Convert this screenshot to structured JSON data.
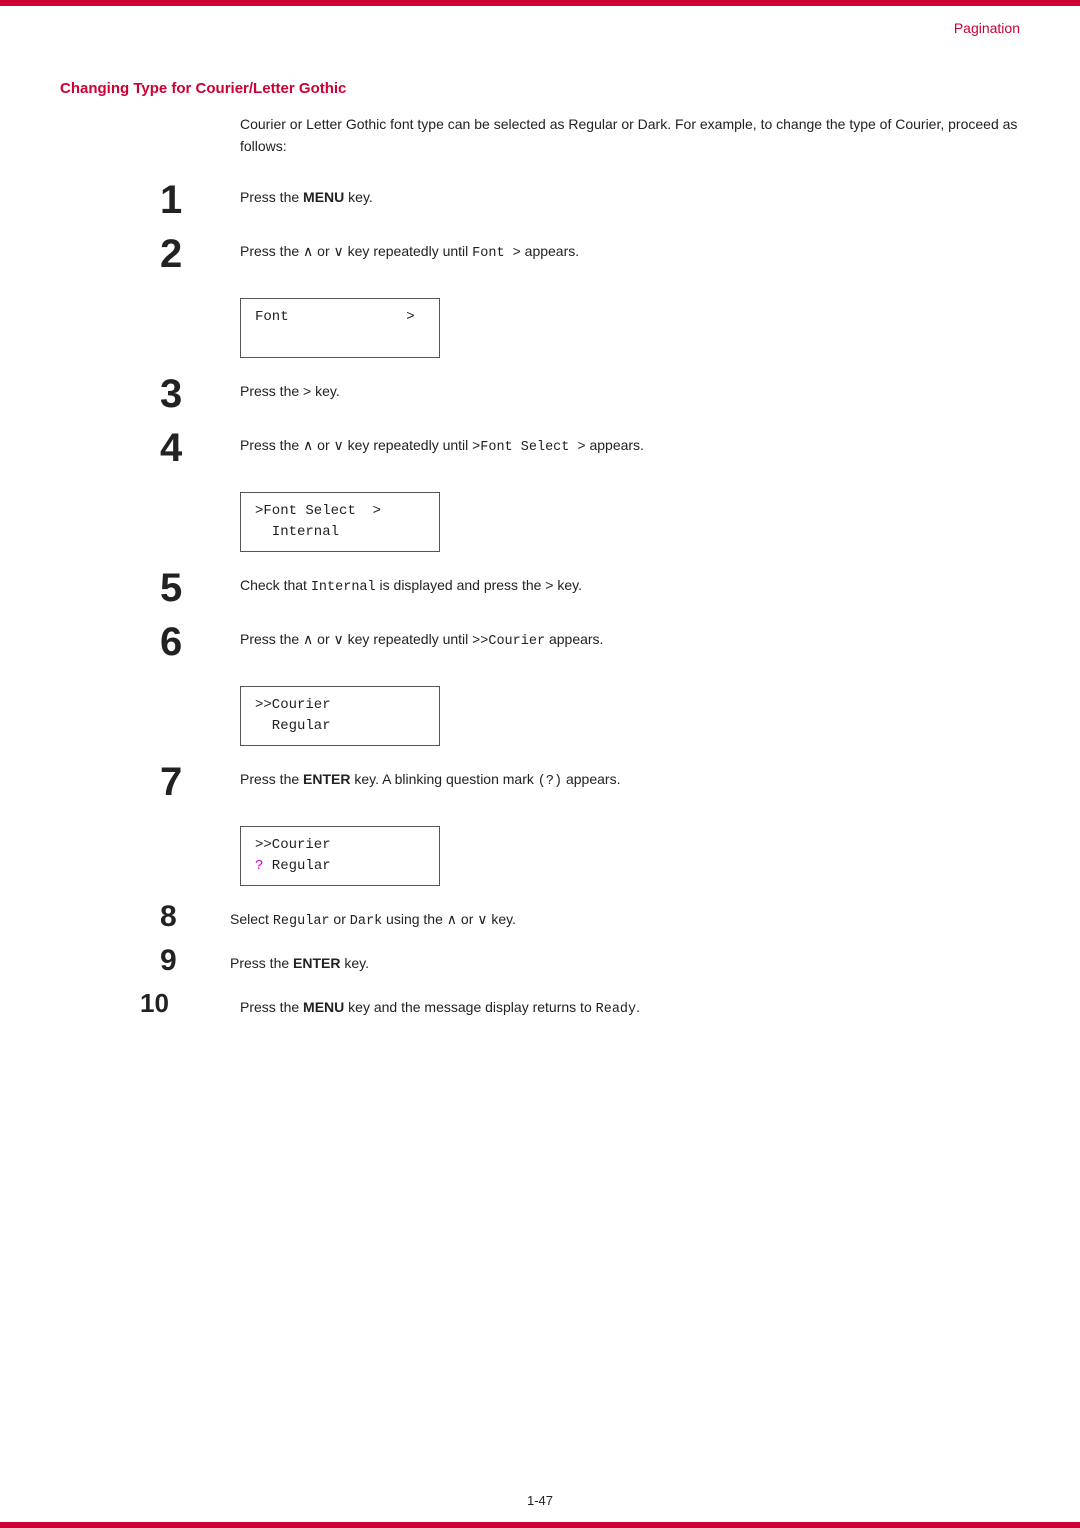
{
  "header": {
    "pagination_label": "Pagination",
    "page_number": "1-47"
  },
  "section": {
    "title": "Changing Type for Courier/Letter Gothic",
    "intro": "Courier or Letter Gothic font type can be selected as Regular or Dark. For example, to change the type of Courier, proceed as follows:"
  },
  "steps": [
    {
      "number": "1",
      "text_parts": [
        "Press the ",
        "MENU",
        " key."
      ],
      "bold_word": "MENU"
    },
    {
      "number": "2",
      "text_before": "Press the ∧ or ∨ key repeatedly until ",
      "code": "Font >",
      "text_after": " appears.",
      "lcd": {
        "line1": "Font              >",
        "line2": ""
      }
    },
    {
      "number": "3",
      "text_parts": [
        "Press the > key."
      ]
    },
    {
      "number": "4",
      "text_before": "Press the ∧ or ∨ key repeatedly until ",
      "code": ">Font Select >",
      "text_after": " appears.",
      "lcd": {
        "line1": ">Font Select  >",
        "line2": "  Internal"
      }
    },
    {
      "number": "5",
      "text_before": "Check that ",
      "code": "Internal",
      "text_after": " is displayed and press the > key."
    },
    {
      "number": "6",
      "text_before": "Press the ∧ or ∨ key repeatedly until ",
      "code": ">>Courier",
      "text_after": " appears.",
      "lcd": {
        "line1": ">>Courier",
        "line2": "  Regular"
      }
    },
    {
      "number": "7",
      "text_before": "Press the ",
      "bold": "ENTER",
      "text_middle": " key. A blinking question mark ",
      "code": "(?)",
      "text_after": " appears.",
      "lcd": {
        "line1": ">>Courier",
        "line2": "? Regular"
      },
      "has_cursor": true
    },
    {
      "number": "8",
      "text_before": "Select ",
      "code1": "Regular",
      "text_middle": " or ",
      "code2": "Dark",
      "text_after": " using the ∧ or ∨ key."
    },
    {
      "number": "9",
      "text_parts": [
        "Press the ",
        "ENTER",
        " key."
      ]
    },
    {
      "number": "10",
      "text_before": "Press the ",
      "bold": "MENU",
      "text_middle": " key and the message display returns to ",
      "code": "Ready",
      "text_after": "."
    }
  ]
}
